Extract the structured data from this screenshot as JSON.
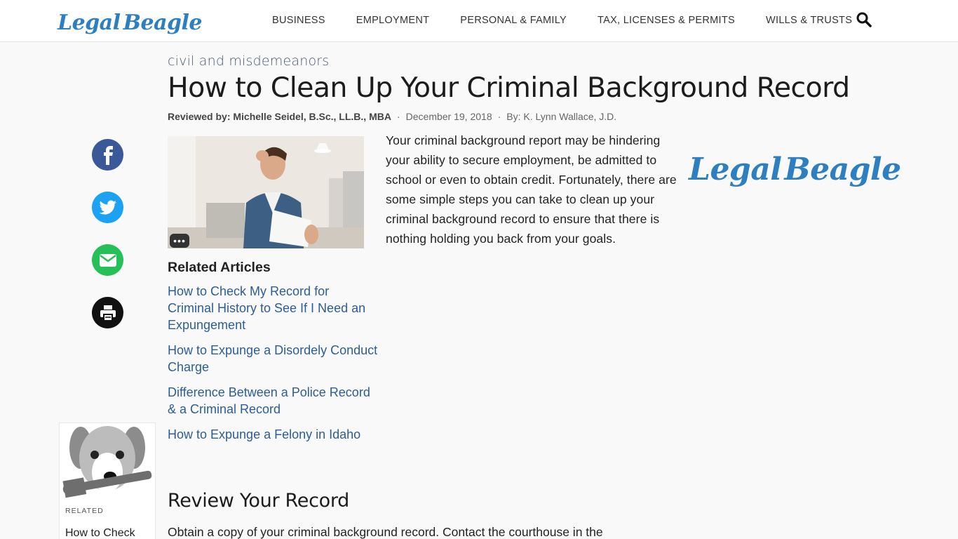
{
  "header": {
    "logo_left": "Legal",
    "logo_right": "Beagle",
    "nav": [
      "BUSINESS",
      "EMPLOYMENT",
      "PERSONAL & FAMILY",
      "TAX, LICENSES & PERMITS",
      "WILLS & TRUSTS"
    ]
  },
  "article": {
    "category": "civil and misdemeanors",
    "title": "How to Clean Up Your Criminal Background Record",
    "reviewed_by": "Reviewed by: Michelle Seidel, B.Sc., LL.B., MBA",
    "date": "December 19, 2018",
    "author": "By: K. Lynn Wallace, J.D.",
    "separator": "·",
    "intro": "Your criminal background report may be hindering your ability to secure employment, be admitted to school or even to obtain credit. Fortunately, there are some simple steps you can take to clean up your criminal background record to ensure that there is nothing holding you back from your goals.",
    "image_more": "•••"
  },
  "social": [
    "facebook-icon",
    "twitter-icon",
    "email-icon",
    "print-icon"
  ],
  "related": {
    "heading": "Related Articles",
    "items": [
      "How to Check My Record for Criminal History to See If I Need an Expungement",
      "How to Expunge a Disordely Conduct Charge",
      "Difference Between a Police Record & a Criminal Record",
      "How to Expunge a Felony in Idaho"
    ]
  },
  "related_card": {
    "label": "RELATED",
    "title": "How to Check"
  },
  "section": {
    "heading": "Review Your Record",
    "text": "Obtain a copy of your criminal background record. Contact the courthouse in the"
  },
  "colors": {
    "brand_blue": "#2d7fc0",
    "link": "#2c5d96",
    "facebook": "#3b5998",
    "twitter": "#1da1f2",
    "email": "#25c057",
    "print": "#111111"
  }
}
